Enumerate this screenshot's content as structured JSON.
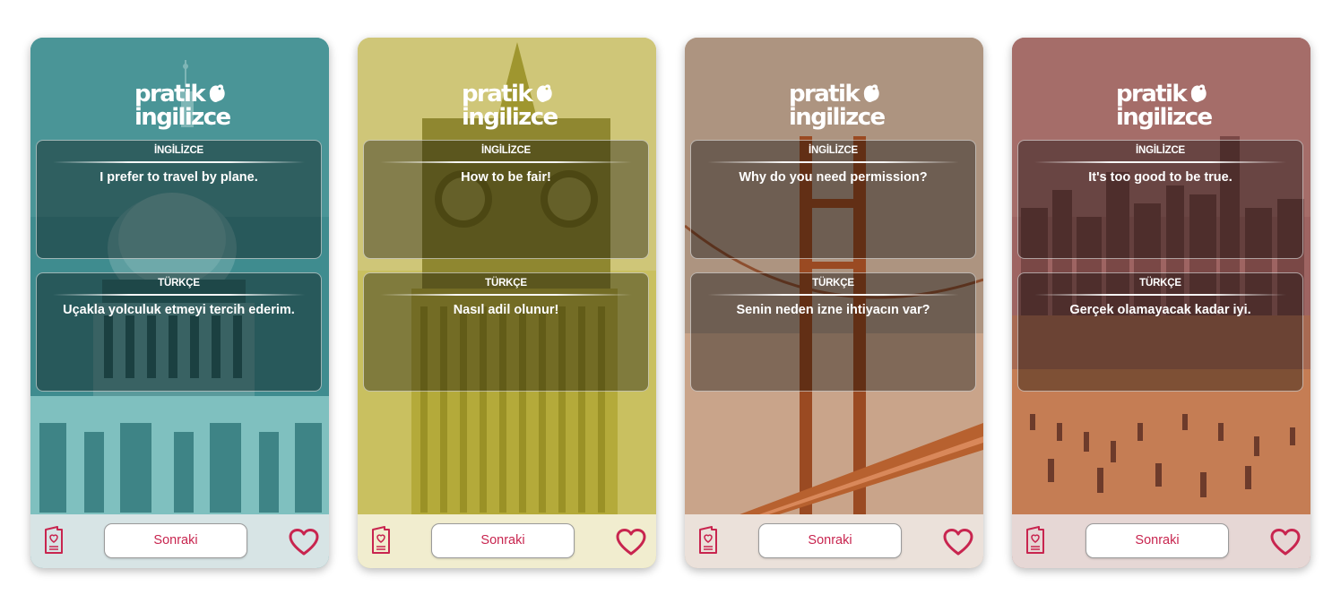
{
  "colors": {
    "accent": "#c8254f",
    "text_on_panel": "#ffffff"
  },
  "logo": {
    "line1": "pratik",
    "line2": "ingilizce"
  },
  "cards": [
    {
      "theme_color": "#3f8c8f",
      "footer_color": "#d7e4e5",
      "scene": "dome",
      "english_label": "İNGİLİZCE",
      "english_text": "I prefer to travel by plane.",
      "turkish_label": "TÜRKÇE",
      "turkish_text": "Uçakla yolculuk etmeyi tercih ederim.",
      "next_label": "Sonraki",
      "left_icon": "heart-card-icon",
      "right_icon": "heart-icon"
    },
    {
      "theme_color": "#c9c060",
      "footer_color": "#f1edcf",
      "scene": "clocktower",
      "english_label": "İNGİLİZCE",
      "english_text": "How to be fair!",
      "turkish_label": "TÜRKÇE",
      "turkish_text": "Nasıl adil olunur!",
      "next_label": "Sonraki",
      "left_icon": "heart-card-icon",
      "right_icon": "heart-icon"
    },
    {
      "theme_color": "#b49a86",
      "footer_color": "#ebe1da",
      "scene": "bridge",
      "english_label": "İNGİLİZCE",
      "english_text": "Why do you need permission?",
      "turkish_label": "TÜRKÇE",
      "turkish_text": "Senin neden izne ihtiyacın var?",
      "next_label": "Sonraki",
      "left_icon": "heart-card-icon",
      "right_icon": "heart-icon"
    },
    {
      "theme_color": "#9e6462",
      "footer_color": "#e6d7d5",
      "scene": "skyline",
      "english_label": "İNGİLİZCE",
      "english_text": "It's too good to be true.",
      "turkish_label": "TÜRKÇE",
      "turkish_text": "Gerçek olamayacak kadar iyi.",
      "next_label": "Sonraki",
      "left_icon": "heart-card-icon",
      "right_icon": "heart-icon"
    }
  ]
}
